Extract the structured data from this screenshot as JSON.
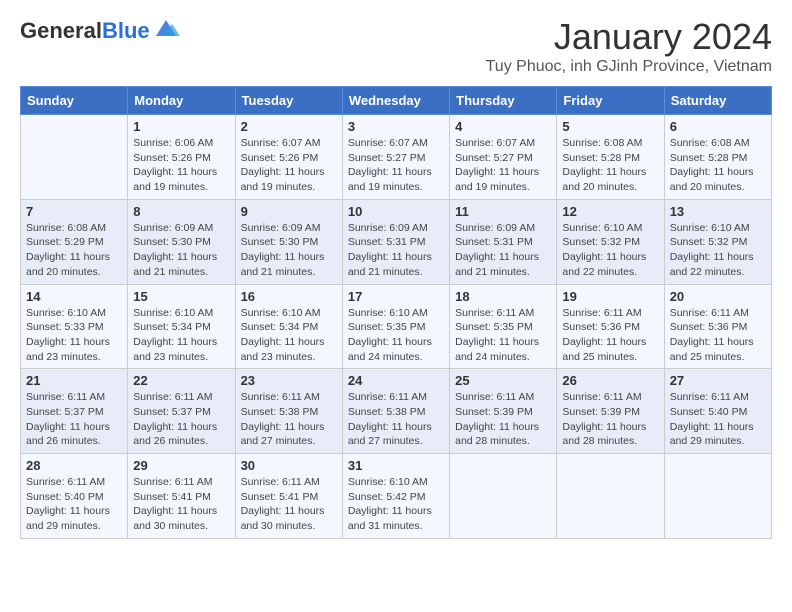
{
  "logo": {
    "general": "General",
    "blue": "Blue"
  },
  "header": {
    "title": "January 2024",
    "subtitle": "Tuy Phuoc, inh GJinh Province, Vietnam"
  },
  "weekdays": [
    "Sunday",
    "Monday",
    "Tuesday",
    "Wednesday",
    "Thursday",
    "Friday",
    "Saturday"
  ],
  "weeks": [
    [
      {
        "day": "",
        "sunrise": "",
        "sunset": "",
        "daylight": ""
      },
      {
        "day": "1",
        "sunrise": "Sunrise: 6:06 AM",
        "sunset": "Sunset: 5:26 PM",
        "daylight": "Daylight: 11 hours and 19 minutes."
      },
      {
        "day": "2",
        "sunrise": "Sunrise: 6:07 AM",
        "sunset": "Sunset: 5:26 PM",
        "daylight": "Daylight: 11 hours and 19 minutes."
      },
      {
        "day": "3",
        "sunrise": "Sunrise: 6:07 AM",
        "sunset": "Sunset: 5:27 PM",
        "daylight": "Daylight: 11 hours and 19 minutes."
      },
      {
        "day": "4",
        "sunrise": "Sunrise: 6:07 AM",
        "sunset": "Sunset: 5:27 PM",
        "daylight": "Daylight: 11 hours and 19 minutes."
      },
      {
        "day": "5",
        "sunrise": "Sunrise: 6:08 AM",
        "sunset": "Sunset: 5:28 PM",
        "daylight": "Daylight: 11 hours and 20 minutes."
      },
      {
        "day": "6",
        "sunrise": "Sunrise: 6:08 AM",
        "sunset": "Sunset: 5:28 PM",
        "daylight": "Daylight: 11 hours and 20 minutes."
      }
    ],
    [
      {
        "day": "7",
        "sunrise": "Sunrise: 6:08 AM",
        "sunset": "Sunset: 5:29 PM",
        "daylight": "Daylight: 11 hours and 20 minutes."
      },
      {
        "day": "8",
        "sunrise": "Sunrise: 6:09 AM",
        "sunset": "Sunset: 5:30 PM",
        "daylight": "Daylight: 11 hours and 21 minutes."
      },
      {
        "day": "9",
        "sunrise": "Sunrise: 6:09 AM",
        "sunset": "Sunset: 5:30 PM",
        "daylight": "Daylight: 11 hours and 21 minutes."
      },
      {
        "day": "10",
        "sunrise": "Sunrise: 6:09 AM",
        "sunset": "Sunset: 5:31 PM",
        "daylight": "Daylight: 11 hours and 21 minutes."
      },
      {
        "day": "11",
        "sunrise": "Sunrise: 6:09 AM",
        "sunset": "Sunset: 5:31 PM",
        "daylight": "Daylight: 11 hours and 21 minutes."
      },
      {
        "day": "12",
        "sunrise": "Sunrise: 6:10 AM",
        "sunset": "Sunset: 5:32 PM",
        "daylight": "Daylight: 11 hours and 22 minutes."
      },
      {
        "day": "13",
        "sunrise": "Sunrise: 6:10 AM",
        "sunset": "Sunset: 5:32 PM",
        "daylight": "Daylight: 11 hours and 22 minutes."
      }
    ],
    [
      {
        "day": "14",
        "sunrise": "Sunrise: 6:10 AM",
        "sunset": "Sunset: 5:33 PM",
        "daylight": "Daylight: 11 hours and 23 minutes."
      },
      {
        "day": "15",
        "sunrise": "Sunrise: 6:10 AM",
        "sunset": "Sunset: 5:34 PM",
        "daylight": "Daylight: 11 hours and 23 minutes."
      },
      {
        "day": "16",
        "sunrise": "Sunrise: 6:10 AM",
        "sunset": "Sunset: 5:34 PM",
        "daylight": "Daylight: 11 hours and 23 minutes."
      },
      {
        "day": "17",
        "sunrise": "Sunrise: 6:10 AM",
        "sunset": "Sunset: 5:35 PM",
        "daylight": "Daylight: 11 hours and 24 minutes."
      },
      {
        "day": "18",
        "sunrise": "Sunrise: 6:11 AM",
        "sunset": "Sunset: 5:35 PM",
        "daylight": "Daylight: 11 hours and 24 minutes."
      },
      {
        "day": "19",
        "sunrise": "Sunrise: 6:11 AM",
        "sunset": "Sunset: 5:36 PM",
        "daylight": "Daylight: 11 hours and 25 minutes."
      },
      {
        "day": "20",
        "sunrise": "Sunrise: 6:11 AM",
        "sunset": "Sunset: 5:36 PM",
        "daylight": "Daylight: 11 hours and 25 minutes."
      }
    ],
    [
      {
        "day": "21",
        "sunrise": "Sunrise: 6:11 AM",
        "sunset": "Sunset: 5:37 PM",
        "daylight": "Daylight: 11 hours and 26 minutes."
      },
      {
        "day": "22",
        "sunrise": "Sunrise: 6:11 AM",
        "sunset": "Sunset: 5:37 PM",
        "daylight": "Daylight: 11 hours and 26 minutes."
      },
      {
        "day": "23",
        "sunrise": "Sunrise: 6:11 AM",
        "sunset": "Sunset: 5:38 PM",
        "daylight": "Daylight: 11 hours and 27 minutes."
      },
      {
        "day": "24",
        "sunrise": "Sunrise: 6:11 AM",
        "sunset": "Sunset: 5:38 PM",
        "daylight": "Daylight: 11 hours and 27 minutes."
      },
      {
        "day": "25",
        "sunrise": "Sunrise: 6:11 AM",
        "sunset": "Sunset: 5:39 PM",
        "daylight": "Daylight: 11 hours and 28 minutes."
      },
      {
        "day": "26",
        "sunrise": "Sunrise: 6:11 AM",
        "sunset": "Sunset: 5:39 PM",
        "daylight": "Daylight: 11 hours and 28 minutes."
      },
      {
        "day": "27",
        "sunrise": "Sunrise: 6:11 AM",
        "sunset": "Sunset: 5:40 PM",
        "daylight": "Daylight: 11 hours and 29 minutes."
      }
    ],
    [
      {
        "day": "28",
        "sunrise": "Sunrise: 6:11 AM",
        "sunset": "Sunset: 5:40 PM",
        "daylight": "Daylight: 11 hours and 29 minutes."
      },
      {
        "day": "29",
        "sunrise": "Sunrise: 6:11 AM",
        "sunset": "Sunset: 5:41 PM",
        "daylight": "Daylight: 11 hours and 30 minutes."
      },
      {
        "day": "30",
        "sunrise": "Sunrise: 6:11 AM",
        "sunset": "Sunset: 5:41 PM",
        "daylight": "Daylight: 11 hours and 30 minutes."
      },
      {
        "day": "31",
        "sunrise": "Sunrise: 6:10 AM",
        "sunset": "Sunset: 5:42 PM",
        "daylight": "Daylight: 11 hours and 31 minutes."
      },
      {
        "day": "",
        "sunrise": "",
        "sunset": "",
        "daylight": ""
      },
      {
        "day": "",
        "sunrise": "",
        "sunset": "",
        "daylight": ""
      },
      {
        "day": "",
        "sunrise": "",
        "sunset": "",
        "daylight": ""
      }
    ]
  ]
}
